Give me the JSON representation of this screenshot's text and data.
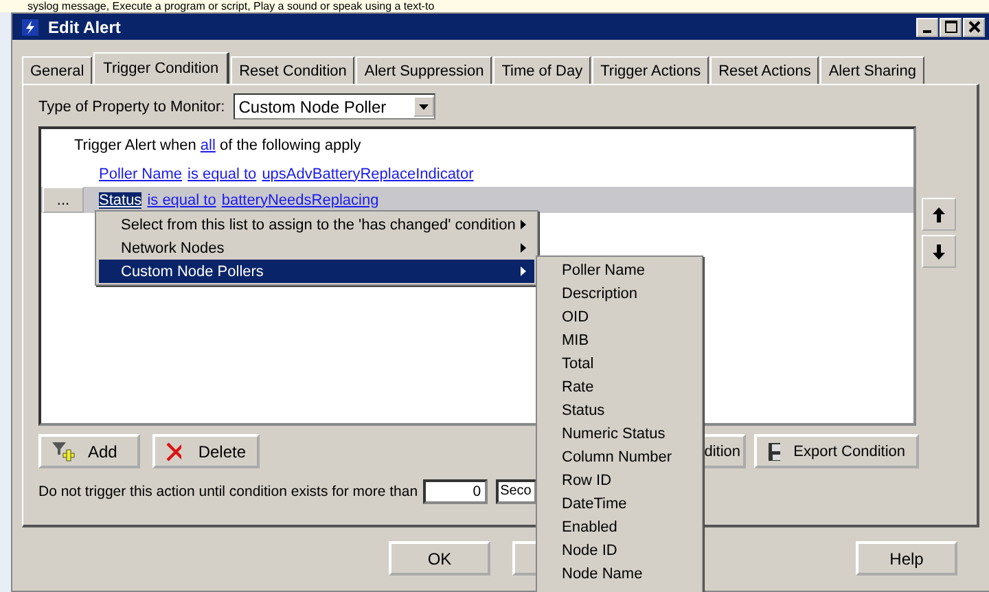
{
  "background_page": {
    "text": "syslog message, Execute a program or script, Play a sound or speak using a text-to"
  },
  "window": {
    "title": "Edit Alert"
  },
  "tabs": [
    {
      "label": "General",
      "selected": false
    },
    {
      "label": "Trigger Condition",
      "selected": true
    },
    {
      "label": "Reset Condition",
      "selected": false
    },
    {
      "label": "Alert Suppression",
      "selected": false
    },
    {
      "label": "Time of Day",
      "selected": false
    },
    {
      "label": "Trigger Actions",
      "selected": false
    },
    {
      "label": "Reset Actions",
      "selected": false
    },
    {
      "label": "Alert Sharing",
      "selected": false
    }
  ],
  "property": {
    "label": "Type of Property to Monitor:",
    "value": "Custom Node Poller"
  },
  "conditions": {
    "header": {
      "prefix": "Trigger Alert when",
      "link": "all",
      "suffix": "of the following apply"
    },
    "rows": [
      {
        "field": "Poller Name",
        "operator": "is equal to",
        "value": "upsAdvBatteryReplaceIndicator",
        "selected": false
      },
      {
        "field": "Status",
        "operator": "is equal to",
        "value": "batteryNeedsReplacing",
        "selected": true,
        "button": "..."
      }
    ]
  },
  "context_menu": [
    {
      "label": "Select from this list to assign to the 'has changed' condition",
      "selected": false
    },
    {
      "label": "Network Nodes",
      "selected": false
    },
    {
      "label": "Custom Node Pollers",
      "selected": true
    }
  ],
  "submenu": [
    "Poller Name",
    "Description",
    "OID",
    "MIB",
    "Total",
    "Rate",
    "Status",
    "Numeric Status",
    "Column Number",
    "Row ID",
    "DateTime",
    "Enabled",
    "Node ID",
    "Node Name"
  ],
  "condition_buttons": {
    "add": "Add",
    "delete": "Delete",
    "import_partial": "dition",
    "export": "Export Condition"
  },
  "delay": {
    "label": "Do not trigger this action until condition exists for more than",
    "value": "0",
    "unit": "Seco"
  },
  "footer_buttons": {
    "ok": "OK",
    "help": "Help"
  }
}
